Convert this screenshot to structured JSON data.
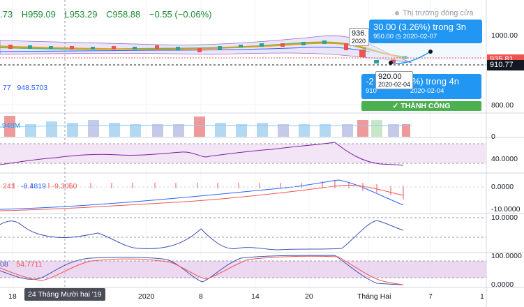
{
  "header": {
    "open": ".73",
    "high": "H959.09",
    "low": "L953.29",
    "close": "C958.88",
    "change": "−0.55 (−0.06%)",
    "market_status": "Thị trường đóng cửa"
  },
  "price_axis": {
    "labels": [
      "1000.00",
      "800.00",
      "0",
      "40.0000",
      "0.0000",
      "-10.0000",
      "10.0000",
      "100.0000",
      "0.0000"
    ],
    "current_price": "935.81",
    "crosshair_price": "910.77"
  },
  "long_position": {
    "title": "30.00 (3.26%) trong 3n",
    "detail": "950.00",
    "date": "2020-02-07"
  },
  "short_position": {
    "title": "-2",
    "title_tail": "4%) trong 4n",
    "detail": "910",
    "date": "2020-02-04"
  },
  "point_label_top": {
    "value": "936.",
    "date": "2020"
  },
  "point_label_bottom": {
    "value": "920.00",
    "date": "2020-02-04"
  },
  "result_badge": "✓  THÀNH CÔNG",
  "panes": {
    "ma": {
      "v1": "77",
      "v2": "948.5703"
    },
    "volume": {
      "v1": "948M"
    },
    "macd": {
      "v1": "241",
      "v2": "-8.4819",
      "v3": "-9.3060"
    },
    "stoch": {
      "v1": "08",
      "v2": "54.7711"
    }
  },
  "time_axis": {
    "labels": [
      "18",
      "2020",
      "8",
      "14",
      "20",
      "Tháng Hai",
      "7",
      "1"
    ],
    "crosshair_date": "24 Tháng Mười hai '19"
  },
  "colors": {
    "up": "#26a69a",
    "down": "#ef5350",
    "accent": "#2196f3",
    "success": "#4caf50",
    "purple_band": "#e1bee7"
  }
}
